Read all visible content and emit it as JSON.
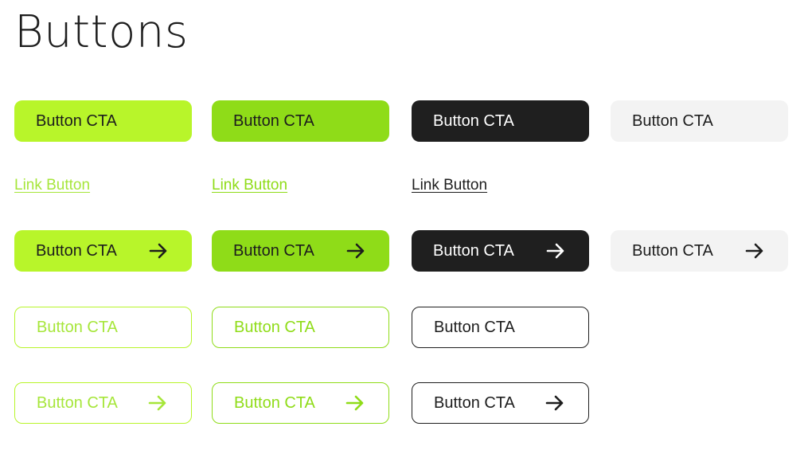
{
  "title": "Buttons",
  "colors": {
    "lime": "#b8f52a",
    "green": "#8fdc18",
    "dark": "#1f1f1f",
    "light": "#f3f3f3"
  },
  "rows": {
    "solid": [
      "Button CTA",
      "Button CTA",
      "Button CTA",
      "Button CTA"
    ],
    "links": [
      "Link Button",
      "Link Button",
      "Link Button"
    ],
    "solid_arrow": [
      "Button CTA",
      "Button CTA",
      "Button CTA",
      "Button CTA"
    ],
    "outline": [
      "Button CTA",
      "Button CTA",
      "Button CTA"
    ],
    "outline_arrow": [
      "Button CTA",
      "Button CTA",
      "Button CTA"
    ]
  },
  "icons": {
    "arrow": "arrow-right-icon"
  }
}
